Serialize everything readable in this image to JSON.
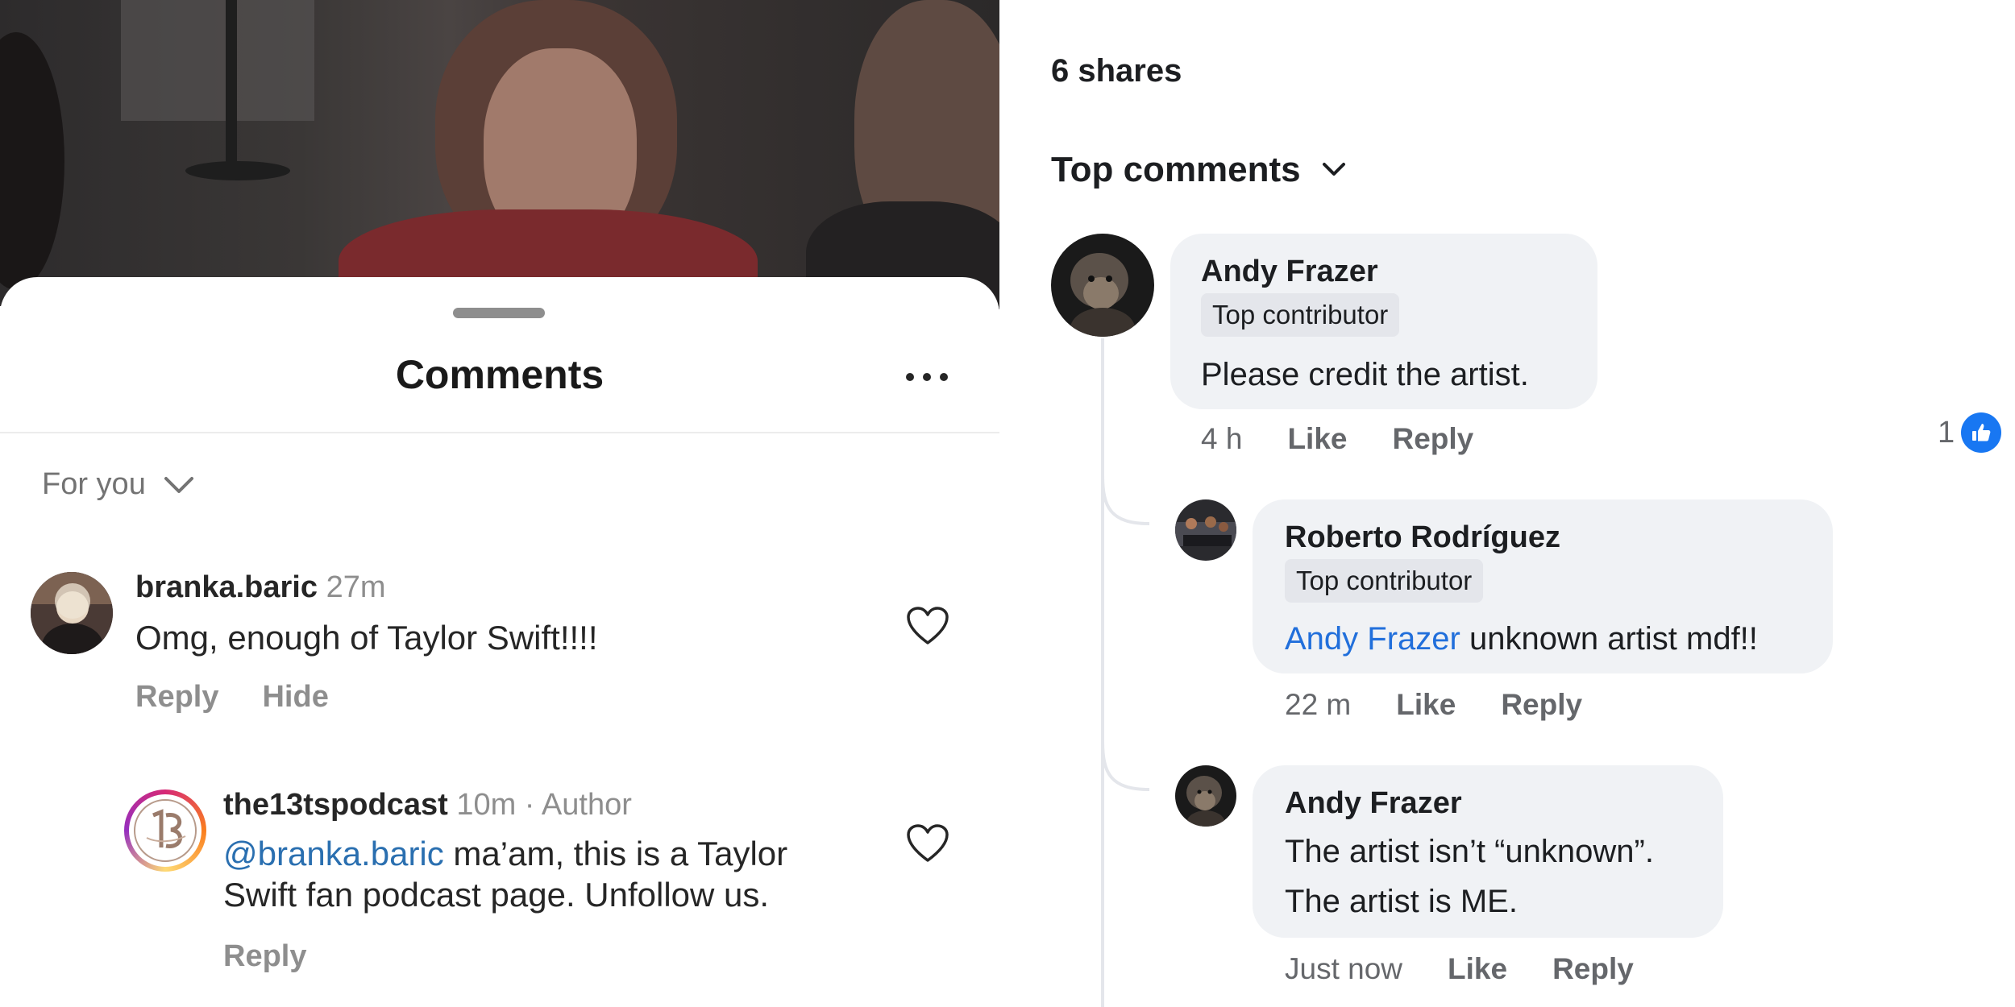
{
  "instagram": {
    "sheet_title": "Comments",
    "sort_label": "For you",
    "comments": [
      {
        "username": "branka.baric",
        "time": "27m",
        "text": "Omg, enough of Taylor Swift!!!!",
        "actions": [
          "Reply",
          "Hide"
        ]
      },
      {
        "username": "the13tspodcast",
        "time": "10m",
        "author_tag": "· Author",
        "mention": "@branka.baric",
        "text_line1": " ma’am, this is a Taylor",
        "text_line2": "Swift fan podcast page. Unfollow us.",
        "actions": [
          "Reply"
        ]
      }
    ],
    "icons": [
      "more-icon",
      "chevron-down-icon",
      "heart-icon"
    ]
  },
  "facebook": {
    "shares": "6 shares",
    "sort_label": "Top comments",
    "comments": [
      {
        "name": "Andy Frazer",
        "badge": "Top contributor",
        "text": "Please credit the artist.",
        "time": "4 h",
        "like": "Like",
        "reply": "Reply",
        "reaction_count": "1"
      },
      {
        "name": "Roberto Rodríguez",
        "badge": "Top contributor",
        "mention": "Andy Frazer",
        "text": " unknown artist mdf!!",
        "time": "22 m",
        "like": "Like",
        "reply": "Reply"
      },
      {
        "name": "Andy Frazer",
        "text_line1": "The artist isn’t “unknown”.",
        "text_line2": "The artist is ME.",
        "time": "Just now",
        "like": "Like",
        "reply": "Reply"
      }
    ],
    "colors": {
      "link": "#216fdb",
      "like_reaction": "#1877f2",
      "bubble": "#f0f2f5"
    }
  }
}
